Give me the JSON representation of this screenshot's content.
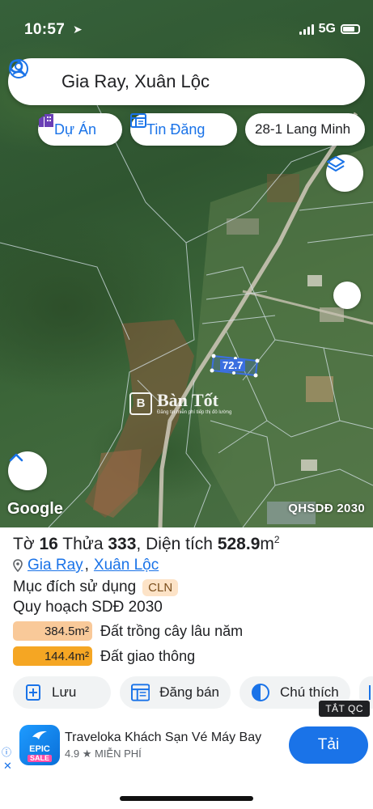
{
  "status_bar": {
    "time": "10:57",
    "network": "5G"
  },
  "search": {
    "query": "Gia Ray, Xuân Lộc"
  },
  "chips": {
    "du_an": "Dự Án",
    "tin_dang": "Tin Đăng",
    "location": "28-1 Lang Minh"
  },
  "map": {
    "provider": "Google",
    "layer_tag": "QHSDĐ 2030",
    "parcel_label": "72.7",
    "watermark_title": "Bàn Tốt",
    "watermark_sub": "Đăng tin miễn phí tiếp thị đô lường"
  },
  "parcel": {
    "to_label": "Tờ",
    "to_value": "16",
    "thua_label": "Thửa",
    "thua_value": "333",
    "area_label": "Diện tích",
    "area_value": "528.9",
    "area_unit": "m",
    "area_sup": "2",
    "commune": "Gia Ray",
    "district": "Xuân Lộc",
    "purpose_label": "Mục đích sử dụng",
    "purpose_code": "CLN",
    "plan_label": "Quy hoạch SDĐ 2030",
    "land_uses": [
      {
        "area": "384.5m²",
        "name": "Đất trồng cây lâu năm",
        "color": "#f9c999",
        "fraction": 0.727
      },
      {
        "area": "144.4m²",
        "name": "Đất giao thông",
        "color": "#f5a623",
        "fraction": 0.273
      }
    ]
  },
  "actions": {
    "save": "Lưu",
    "post": "Đăng bán",
    "legend": "Chú thích"
  },
  "ad": {
    "close_tag": "TẮT QC",
    "title": "Traveloka Khách Sạn Vé Máy Bay",
    "rating": "4.9",
    "price": "MIỄN PHÍ",
    "install": "Tải",
    "icon_top": "EPIC",
    "icon_bottom": "SALE",
    "info_icon": "ⓘ",
    "close_icon": "✕"
  },
  "colors": {
    "accent": "#1a73e8",
    "parcel_outline": "#3b6fe0"
  }
}
